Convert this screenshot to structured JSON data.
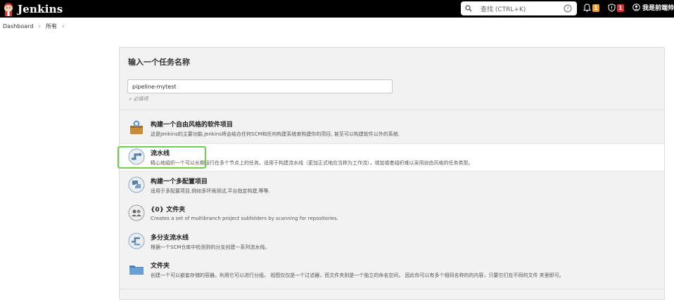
{
  "header": {
    "app_name": "Jenkins",
    "search_placeholder": "查找 (CTRL+K)",
    "notifications_count": "1",
    "security_count": "1",
    "user_name": "我是前端帅"
  },
  "breadcrumb": [
    "Dashboard",
    "所有"
  ],
  "form": {
    "heading": "输入一个任务名称",
    "item_name_value": "pipeline-mytest",
    "required_hint": "» 必填项"
  },
  "job_types": [
    {
      "title": "构建一个自由风格的软件项目",
      "description": "这是Jenkins的主要功能.Jenkins将会结合任何SCM和任何构建系统来构建你的项目, 甚至可以构建软件以外的系统.",
      "icon": "freestyle-icon"
    },
    {
      "title": "流水线",
      "description": "精心地组织一个可以长期运行在多个节点上的任务。适用于构建流水线（更加正式地应当称为工作流），增加或者组织难以采用自由风格的任务类型。",
      "icon": "pipeline-icon"
    },
    {
      "title": "构建一个多配置项目",
      "description": "适用于多配置项目,例如多环境测试,平台指定构建,等等.",
      "icon": "multiconfig-icon"
    },
    {
      "title": "{0} 文件夹",
      "description": "Creates a set of multibranch project subfolders by scanning for repositories.",
      "icon": "org-folder-icon"
    },
    {
      "title": "多分支流水线",
      "description": "根据一个SCM仓库中检测到的分支创建一系列流水线。",
      "icon": "multibranch-icon"
    },
    {
      "title": "文件夹",
      "description": "创建一个可以嵌套存储的容器。利用它可以进行分组。 视图仅仅是一个过滤器，而文件夹则是一个独立的命名空间， 因此你可以有多个相同名称的的内容，只要它们在不同的文件 夹里即可。",
      "icon": "folder-icon"
    }
  ],
  "colors": {
    "topbar": "#000000",
    "highlight": "#6bd04a",
    "badge_orange": "#f0a030",
    "badge_red": "#e03030"
  }
}
